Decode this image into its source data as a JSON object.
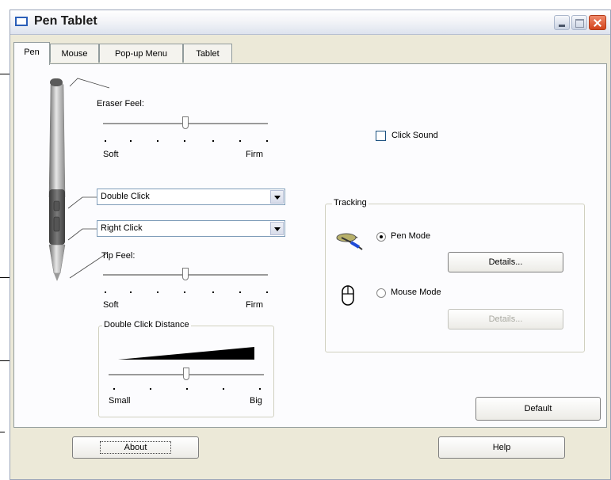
{
  "window": {
    "title": "Pen Tablet"
  },
  "tabs": [
    {
      "label": "Pen",
      "active": true
    },
    {
      "label": "Mouse",
      "active": false
    },
    {
      "label": "Pop-up Menu",
      "active": false
    },
    {
      "label": "Tablet",
      "active": false
    }
  ],
  "pen": {
    "eraser_feel": {
      "label": "Eraser Feel:",
      "min_label": "Soft",
      "max_label": "Firm",
      "level": 0.5
    },
    "button_upper": {
      "value": "Double Click"
    },
    "button_lower": {
      "value": "Right Click"
    },
    "tip_feel": {
      "label": "Tip Feel:",
      "min_label": "Soft",
      "max_label": "Firm",
      "level": 0.5
    },
    "double_click_distance": {
      "label": "Double Click Distance",
      "min_label": "Small",
      "max_label": "Big",
      "level": 0.5
    },
    "click_sound": {
      "label": "Click Sound",
      "checked": false
    },
    "tracking": {
      "label": "Tracking",
      "pen_mode": {
        "label": "Pen Mode",
        "selected": true,
        "details_label": "Details..."
      },
      "mouse_mode": {
        "label": "Mouse Mode",
        "selected": false,
        "details_label": "Details..."
      }
    },
    "default_label": "Default"
  },
  "footer": {
    "about_label": "About",
    "help_label": "Help"
  },
  "icons": {
    "pen_mode": "pen-stylus-icon",
    "mouse_mode": "mouse-icon"
  },
  "colors": {
    "close_button": "#d2431c",
    "tab_border": "#919b9c",
    "panel_bg": "#fcfcfe"
  }
}
